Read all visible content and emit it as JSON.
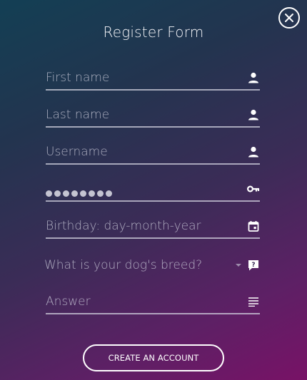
{
  "form": {
    "title": "Register Form",
    "first_name": {
      "placeholder": "First name",
      "icon": "person-icon"
    },
    "last_name": {
      "placeholder": "Last name",
      "icon": "person-icon"
    },
    "username": {
      "placeholder": "Username",
      "icon": "person-icon"
    },
    "password": {
      "masked_length": 8,
      "icon": "key-icon"
    },
    "birthday": {
      "placeholder": "Birthday: day-month-year",
      "icon": "calendar-icon"
    },
    "security_question": {
      "selected": "What is your dog's breed?",
      "icon": "question-icon"
    },
    "answer": {
      "placeholder": "Answer",
      "icon": "subject-lines-icon"
    },
    "submit_label": "CREATE AN ACCOUNT"
  },
  "close_icon": "close-icon",
  "colors": {
    "gradient_start": "#133f54",
    "gradient_mid": "#3b2c57",
    "gradient_end": "#781266",
    "text": "#ffffff",
    "placeholder": "#d0d0de"
  }
}
